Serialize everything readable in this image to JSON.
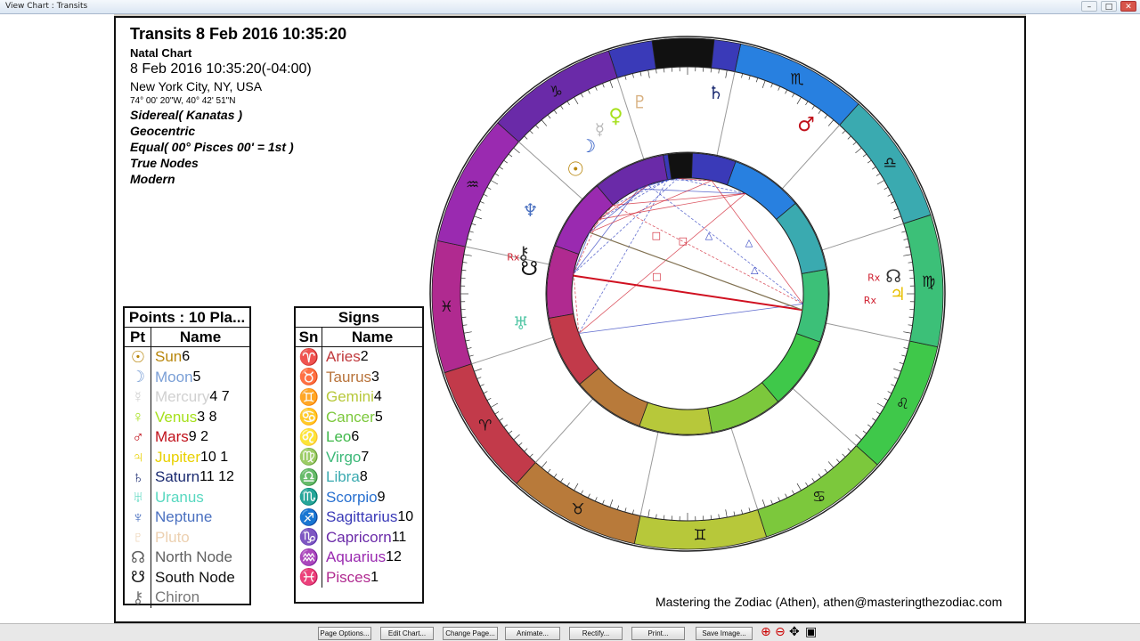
{
  "window": {
    "title": "View Chart : Transits"
  },
  "header": {
    "title": "Transits 8 Feb 2016 10:35:20",
    "subtitle": "Natal Chart",
    "datetime": "8 Feb 2016 10:35:20(-04:00)",
    "location": "New York City, NY, USA",
    "coords": "74° 00' 20\"W, 40° 42' 51\"N",
    "zodiac": "Sidereal( Kanatas )",
    "center": "Geocentric",
    "houses": "Equal( 00° Pisces 00' = 1st )",
    "nodes": "True Nodes",
    "rulers": "Modern"
  },
  "points_table": {
    "title": "Points : 10 Pla...",
    "col_glyph": "Pt",
    "col_name": "Name",
    "rows": [
      {
        "glyph": "☉",
        "name": "Sun",
        "num": "6",
        "color": "#b8860b"
      },
      {
        "glyph": "☽",
        "name": "Moon",
        "num": "5",
        "color": "#7a9fd6"
      },
      {
        "glyph": "☿",
        "name": "Mercury",
        "num": "4 7",
        "color": "#d0d0d0"
      },
      {
        "glyph": "♀",
        "name": "Venus",
        "num": "3  8",
        "color": "#a6e01c"
      },
      {
        "glyph": "♂",
        "name": "Mars",
        "num": "9  2",
        "color": "#c0101a"
      },
      {
        "glyph": "♃",
        "name": "Jupiter",
        "num": "10  1",
        "color": "#e8d000"
      },
      {
        "glyph": "♄",
        "name": "Saturn",
        "num": "11  12",
        "color": "#1a2a70"
      },
      {
        "glyph": "♅",
        "name": "Uranus",
        "num": "",
        "color": "#58d8c0"
      },
      {
        "glyph": "♆",
        "name": "Neptune",
        "num": "",
        "color": "#4a70c0"
      },
      {
        "glyph": "♇",
        "name": "Pluto",
        "num": "",
        "color": "#ecd0b0"
      },
      {
        "glyph": "☊",
        "name": "North Node",
        "num": "",
        "color": "#606060"
      },
      {
        "glyph": "☋",
        "name": "South Node",
        "num": "",
        "color": "#111111"
      },
      {
        "glyph": "⚷",
        "name": "Chiron",
        "num": "",
        "color": "#777777"
      }
    ]
  },
  "signs_table": {
    "title": "Signs",
    "col_glyph": "Sn",
    "col_name": "Name",
    "rows": [
      {
        "glyph": "♈",
        "name": "Aries",
        "num": "2",
        "color": "#c0393c"
      },
      {
        "glyph": "♉",
        "name": "Taurus",
        "num": "3",
        "color": "#b8733a"
      },
      {
        "glyph": "♊",
        "name": "Gemini",
        "num": "4",
        "color": "#b7c83a"
      },
      {
        "glyph": "♋",
        "name": "Cancer",
        "num": "5",
        "color": "#7cc83c"
      },
      {
        "glyph": "♌",
        "name": "Leo",
        "num": "6",
        "color": "#3fb84a"
      },
      {
        "glyph": "♍",
        "name": "Virgo",
        "num": "7",
        "color": "#3cb878"
      },
      {
        "glyph": "♎",
        "name": "Libra",
        "num": "8",
        "color": "#3aaab0"
      },
      {
        "glyph": "♏",
        "name": "Scorpio",
        "num": "9",
        "color": "#2870d0"
      },
      {
        "glyph": "♐",
        "name": "Sagittarius",
        "num": "10",
        "color": "#3a3ab8"
      },
      {
        "glyph": "♑",
        "name": "Capricorn",
        "num": "11",
        "color": "#6a2aa8"
      },
      {
        "glyph": "♒",
        "name": "Aquarius",
        "num": "12",
        "color": "#9a2ab0"
      },
      {
        "glyph": "♓",
        "name": "Pisces",
        "num": "1",
        "color": "#b02a90"
      }
    ]
  },
  "wheel": {
    "sign_colors": [
      "#b02a90",
      "#c23a4a",
      "#b87a3a",
      "#b7c83a",
      "#7cc83c",
      "#3fc84a",
      "#3cc078",
      "#3aaab0",
      "#2880e0",
      "#3a3ab8",
      "#6a2aa8",
      "#9a2ab0"
    ],
    "outer_glyphs": [
      "♓",
      "♈",
      "♉",
      "♊",
      "♋",
      "♌",
      "♍",
      "♎",
      "♏",
      "♐",
      "♑",
      "♒"
    ],
    "transit_planets": [
      {
        "glyph": "♀",
        "color": "#a6e01c"
      },
      {
        "glyph": "♇",
        "color": "#d8b080"
      },
      {
        "glyph": "☿",
        "color": "#b8b8b8"
      },
      {
        "glyph": "♄",
        "color": "#1a2a70"
      },
      {
        "glyph": "♂",
        "color": "#c0101a"
      },
      {
        "glyph": "☽",
        "color": "#2050c0"
      },
      {
        "glyph": "☉",
        "color": "#b8860b"
      },
      {
        "glyph": "♆",
        "color": "#4a70c0"
      },
      {
        "glyph": "⚷",
        "color": "#333333"
      },
      {
        "glyph": "☋",
        "color": "#111111"
      },
      {
        "glyph": "♅",
        "color": "#58c8a8"
      },
      {
        "glyph": "☊",
        "color": "#333333"
      },
      {
        "glyph": "♃",
        "color": "#e8c000"
      }
    ],
    "retro_label": "Rx"
  },
  "credit": "Mastering the Zodiac (Athen), athen@masteringthezodiac.com",
  "toolbar": {
    "buttons": [
      "Page Options...",
      "Edit Chart...",
      "Change Page...",
      "Animate...",
      "Rectify...",
      "Print...",
      "Save Image..."
    ]
  }
}
